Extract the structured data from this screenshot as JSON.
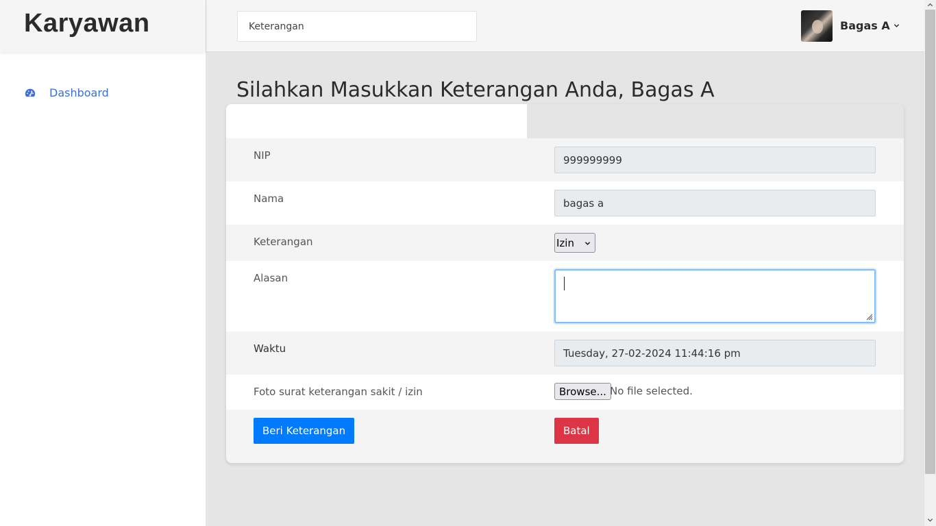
{
  "sidebar": {
    "brand": "Karyawan",
    "items": [
      {
        "label": "Dashboard",
        "icon": "tachometer-icon"
      }
    ],
    "accent_color": "#3f6fd1"
  },
  "header": {
    "search_placeholder": "Keterangan",
    "user_name": "Bagas A"
  },
  "main": {
    "title": "Silahkan Masukkan Keterangan Anda, Bagas A",
    "form": {
      "nip_label": "NIP",
      "nip_value": "999999999",
      "nama_label": "Nama",
      "nama_value": "bagas a",
      "keterangan_label": "Keterangan",
      "keterangan_selected": "Izin",
      "alasan_label": "Alasan",
      "alasan_value": "",
      "waktu_label": "Waktu",
      "waktu_value": "Tuesday, 27-02-2024 11:44:16 pm",
      "foto_label": "Foto surat keterangan sakit / izin",
      "browse_label": "Browse...",
      "file_status": "No file selected.",
      "submit_label": "Beri Keterangan",
      "cancel_label": "Batal"
    },
    "colors": {
      "primary": "#007bff",
      "danger": "#dc3545"
    }
  }
}
